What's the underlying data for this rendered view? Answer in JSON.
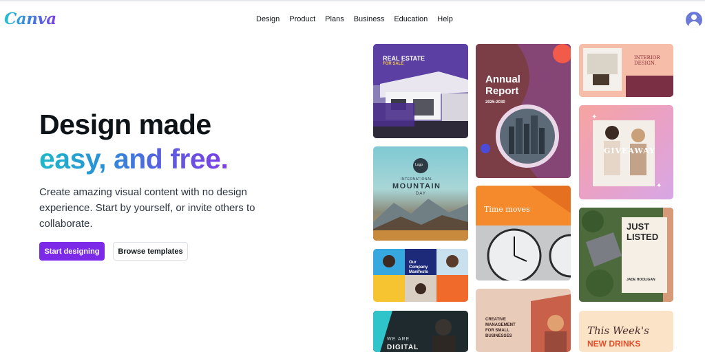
{
  "brand": {
    "logo_text": "Canva"
  },
  "nav": {
    "items": [
      {
        "label": "Design"
      },
      {
        "label": "Product"
      },
      {
        "label": "Plans"
      },
      {
        "label": "Business"
      },
      {
        "label": "Education"
      },
      {
        "label": "Help"
      }
    ]
  },
  "hero": {
    "title_line1": "Design made",
    "title_line2": "easy, and free.",
    "subtitle": "Create amazing visual content with no design experience. Start by yourself, or invite others to collaborate.",
    "primary_button": "Start designing",
    "secondary_button": "Browse templates"
  },
  "templates": {
    "real_estate": {
      "title": "REAL ESTATE",
      "subtitle": "FOR SALE"
    },
    "mountain": {
      "logo": "Logo",
      "line1": "INTERNATIONAL",
      "line2": "MOUNTAIN",
      "line3": "DAY"
    },
    "manifesto": {
      "line1": "Our",
      "line2": "Company",
      "line3": "Manifesto"
    },
    "digital": {
      "line1": "WE ARE",
      "line2": "DIGITAL"
    },
    "annual": {
      "line1": "Annual",
      "line2": "Report",
      "years": "2025-2030"
    },
    "time": {
      "headline": "Time moves"
    },
    "creative": {
      "line1": "CREATIVE",
      "line2": "MANAGEMENT",
      "line3": "FOR SMALL",
      "line4": "BUSINESSES"
    },
    "interior": {
      "line1": "INTERIOR",
      "line2": "DESIGN."
    },
    "giveaway": {
      "headline": "GIVEAWAY"
    },
    "listed": {
      "line1": "JUST",
      "line2": "LISTED",
      "agent": "JADE HOOLIGAN"
    },
    "drinks": {
      "line1": "This Week's",
      "line2": "NEW DRINKS"
    }
  },
  "colors": {
    "primary": "#7d2ae8",
    "gradient_start": "#1fb8c9",
    "gradient_end": "#7d3ee6"
  }
}
